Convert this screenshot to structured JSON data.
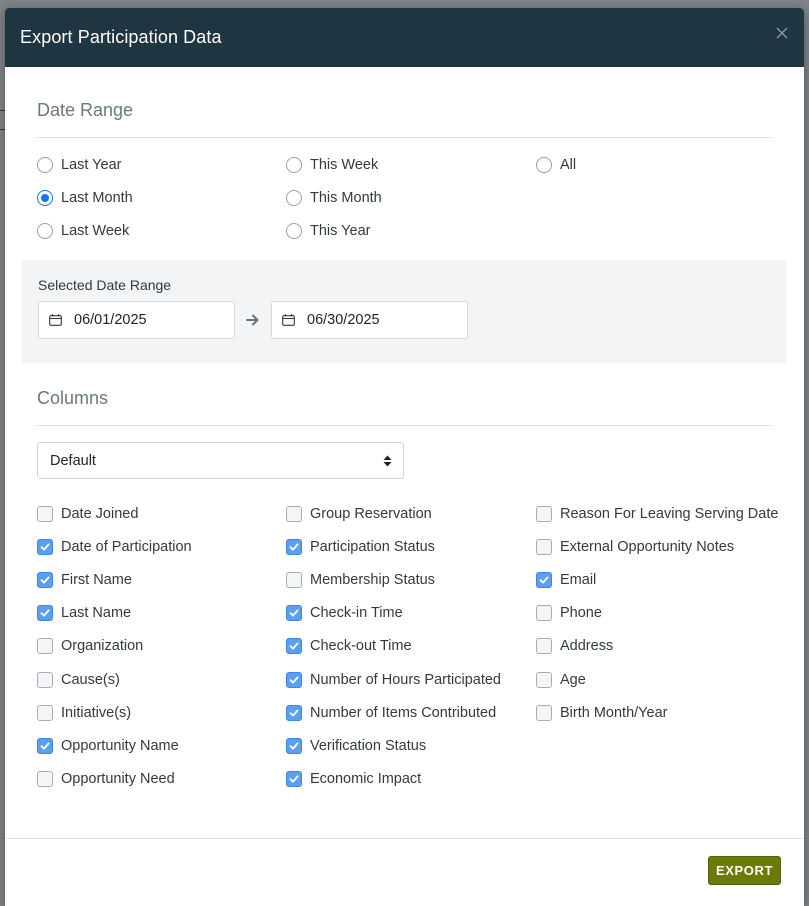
{
  "modal": {
    "title": "Export Participation Data",
    "close_icon": "close-icon"
  },
  "date_range": {
    "heading": "Date Range",
    "options": [
      {
        "label": "Last Year",
        "checked": false
      },
      {
        "label": "Last Month",
        "checked": true
      },
      {
        "label": "Last Week",
        "checked": false
      },
      {
        "label": "This Week",
        "checked": false
      },
      {
        "label": "This Month",
        "checked": false
      },
      {
        "label": "This Year",
        "checked": false
      },
      {
        "label": "All",
        "checked": false
      }
    ],
    "selected_label": "Selected Date Range",
    "start_date": "06/01/2025",
    "end_date": "06/30/2025"
  },
  "columns": {
    "heading": "Columns",
    "preset": "Default",
    "items": [
      {
        "label": "Date Joined",
        "checked": false
      },
      {
        "label": "Date of Participation",
        "checked": true
      },
      {
        "label": "First Name",
        "checked": true
      },
      {
        "label": "Last Name",
        "checked": true
      },
      {
        "label": "Organization",
        "checked": false
      },
      {
        "label": "Cause(s)",
        "checked": false
      },
      {
        "label": "Initiative(s)",
        "checked": false
      },
      {
        "label": "Opportunity Name",
        "checked": true
      },
      {
        "label": "Opportunity Need",
        "checked": false
      },
      {
        "label": "Group Reservation",
        "checked": false
      },
      {
        "label": "Participation Status",
        "checked": true
      },
      {
        "label": "Membership Status",
        "checked": false
      },
      {
        "label": "Check-in Time",
        "checked": true
      },
      {
        "label": "Check-out Time",
        "checked": true
      },
      {
        "label": "Number of Hours Participated",
        "checked": true
      },
      {
        "label": "Number of Items Contributed",
        "checked": true
      },
      {
        "label": "Verification Status",
        "checked": true
      },
      {
        "label": "Economic Impact",
        "checked": true
      },
      {
        "label": "Reason For Leaving Serving Date",
        "checked": false
      },
      {
        "label": "External Opportunity Notes",
        "checked": false
      },
      {
        "label": "Email",
        "checked": true
      },
      {
        "label": "Phone",
        "checked": false
      },
      {
        "label": "Address",
        "checked": false
      },
      {
        "label": "Age",
        "checked": false
      },
      {
        "label": "Birth Month/Year",
        "checked": false
      }
    ]
  },
  "footer": {
    "export_label": "EXPORT"
  },
  "colors": {
    "header_bg": "#1f3541",
    "accent_blue": "#1a73e8",
    "export_green": "#6b7b06"
  }
}
